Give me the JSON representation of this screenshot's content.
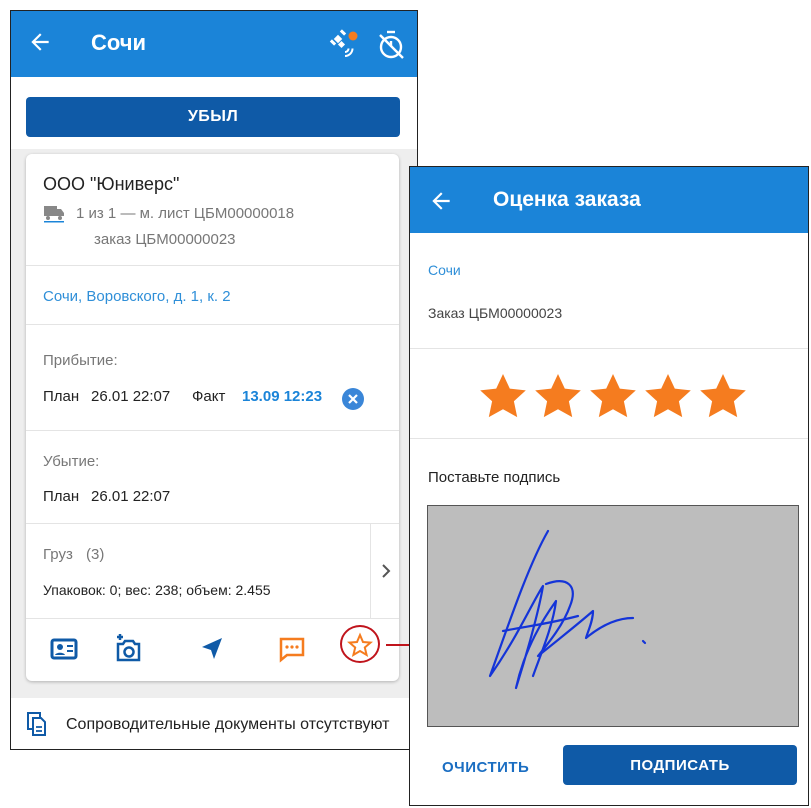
{
  "left": {
    "header": {
      "title": "Сочи"
    },
    "depart_button": "УБЫЛ",
    "card": {
      "company": "ООО \"Юниверс\"",
      "route": "1 из 1 —  м. лист ЦБМ00000018",
      "order": "заказ ЦБМ00000023",
      "address": "Сочи, Воровского, д. 1, к. 2",
      "arrival": {
        "label": "Прибытие:",
        "plan_label": "План",
        "plan_value": "26.01 22:07",
        "fact_label": "Факт",
        "fact_value": "13.09 12:23"
      },
      "departure": {
        "label": "Убытие:",
        "plan_label": "План",
        "plan_value": "26.01 22:07"
      },
      "cargo": {
        "label": "Груз",
        "count": "(3)",
        "details": "Упаковок: 0; вес: 238; объем: 2.455"
      }
    },
    "docs_text": "Сопроводительные документы отсутствуют"
  },
  "right": {
    "header": {
      "title": "Оценка заказа"
    },
    "city": "Сочи",
    "order": "Заказ  ЦБМ00000023",
    "rating": 5,
    "rating_max": 5,
    "sign_label": "Поставьте подпись",
    "clear_button": "ОЧИСТИТЬ",
    "sign_button": "ПОДПИСАТЬ"
  },
  "colors": {
    "header_blue": "#1b84d8",
    "button_blue": "#0f5aa7",
    "link_blue": "#2f8fd8",
    "star_orange": "#f57c1f",
    "highlight_red": "#c0141c",
    "signature_blue": "#1434d8"
  }
}
